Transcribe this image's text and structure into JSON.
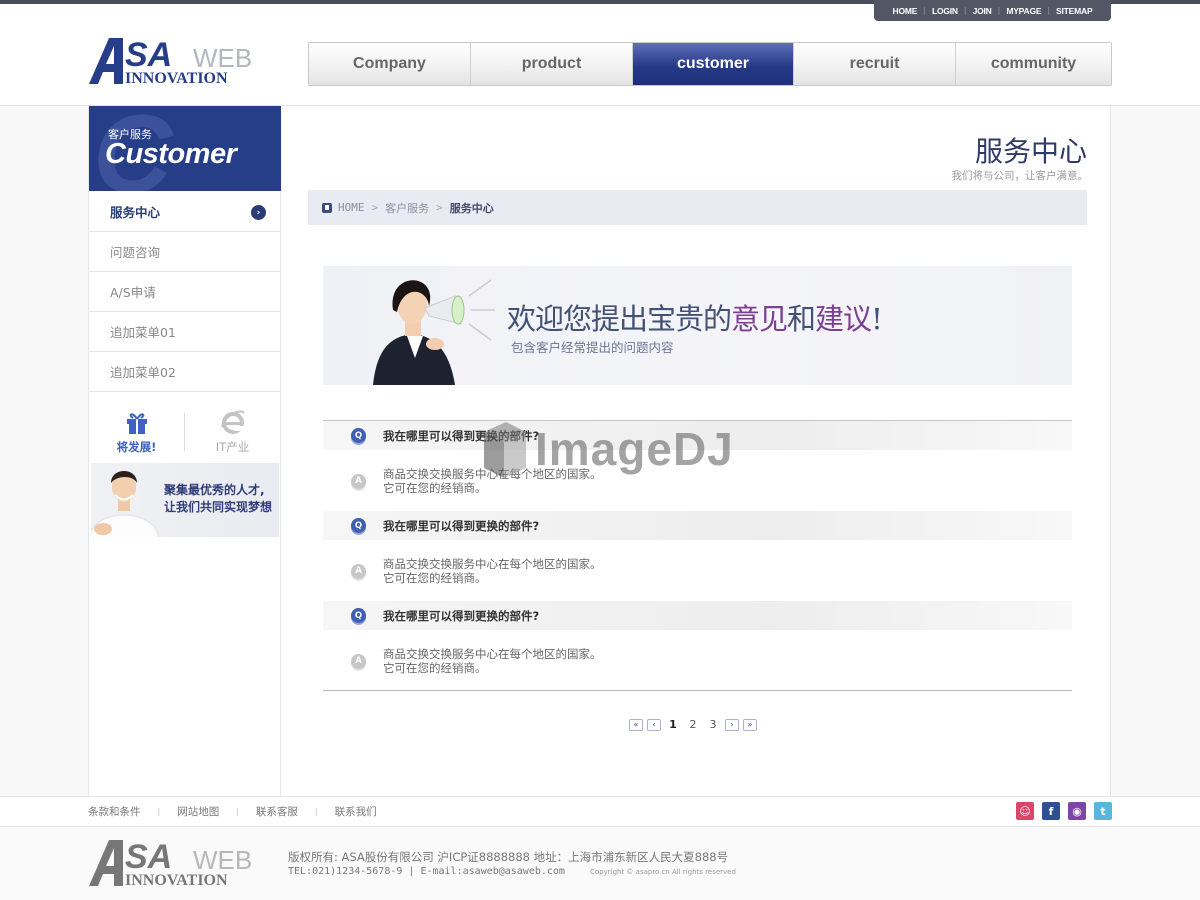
{
  "util_links": [
    "HOME",
    "LOGIN",
    "JOIN",
    "MYPAGE",
    "SITEMAP"
  ],
  "brand": {
    "top": "SA",
    "sub": "WEB",
    "bottom": "INNOVATION",
    "color": "#263d88"
  },
  "nav": [
    {
      "label": "Company"
    },
    {
      "label": "product"
    },
    {
      "label": "customer",
      "active": true
    },
    {
      "label": "recruit"
    },
    {
      "label": "community"
    }
  ],
  "sidebar": {
    "subtitle": "客户服务",
    "title": "Customer",
    "items": [
      {
        "label": "服务中心",
        "active": true
      },
      {
        "label": "问题咨询"
      },
      {
        "label": "A/S申请"
      },
      {
        "label": "追加菜单01"
      },
      {
        "label": "追加菜单02"
      }
    ],
    "icons": [
      {
        "label": "将发展!",
        "icon": "gift-icon"
      },
      {
        "label": "IT产业",
        "icon": "ie-icon"
      }
    ],
    "banner": {
      "line1": "聚集最优秀的人才,",
      "line2": "让我们共同实现梦想"
    }
  },
  "page": {
    "title": "服务中心",
    "subtitle": "我们将与公司，让客户满意。"
  },
  "breadcrumb": {
    "home": "HOME",
    "section": "客户服务",
    "current": "服务中心"
  },
  "banner": {
    "headline_part1": "欢迎您提出宝贵的",
    "headline_accent1": "意见",
    "headline_part2": "和",
    "headline_accent2": "建议",
    "headline_end": "!",
    "subtitle": "包含客户经常提出的问题内容"
  },
  "faq": [
    {
      "q_icon": "Q",
      "question": "我在哪里可以得到更换的部件?",
      "a_icon": "A",
      "answer1": "商品交换交换服务中心在每个地区的国家。",
      "answer2": "它可在您的经销商。"
    },
    {
      "q_icon": "Q",
      "question": "我在哪里可以得到更换的部件?",
      "a_icon": "A",
      "answer1": "商品交换交换服务中心在每个地区的国家。",
      "answer2": "它可在您的经销商。"
    },
    {
      "q_icon": "Q",
      "question": "我在哪里可以得到更换的部件?",
      "a_icon": "A",
      "answer1": "商品交换交换服务中心在每个地区的国家。",
      "answer2": "它可在您的经销商。"
    }
  ],
  "pager": {
    "first": "«",
    "prev": "‹",
    "pages": [
      "1",
      "2",
      "3"
    ],
    "current": "1",
    "next": "›",
    "last": "»"
  },
  "watermark": "ImageDJ",
  "footer": {
    "links": [
      "条款和条件",
      "网站地图",
      "联系客服",
      "联系我们"
    ],
    "social": [
      {
        "icon": "smile-icon",
        "glyph": "☺",
        "color": "#d8486b"
      },
      {
        "icon": "facebook-icon",
        "glyph": "f",
        "color": "#2f4f93"
      },
      {
        "icon": "chat-icon",
        "glyph": "◉",
        "color": "#7d45a6"
      },
      {
        "icon": "twitter-icon",
        "glyph": "t",
        "color": "#58b6dc"
      }
    ],
    "copyright": "版权所有: ASA股份有限公司 沪ICP证8888888 地址：上海市浦东新区人民大夏888号",
    "contact": "TEL:021)1234-5678-9 | E-mail:asaweb@asaweb.com",
    "rights": "Copyright © asapro.cn All rights reserved"
  }
}
